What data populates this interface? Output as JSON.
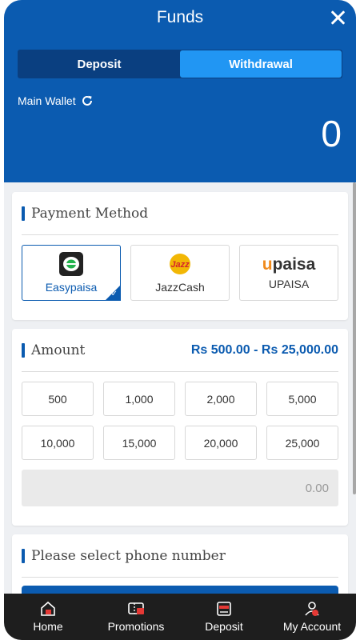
{
  "header": {
    "title": "Funds",
    "tabs": [
      {
        "label": "Deposit",
        "active": false
      },
      {
        "label": "Withdrawal",
        "active": true
      }
    ],
    "wallet_label": "Main Wallet",
    "wallet_value": "0"
  },
  "payment": {
    "title": "Payment Method",
    "methods": [
      {
        "name": "Easypaisa",
        "icon": "easypaisa-logo",
        "selected": true
      },
      {
        "name": "JazzCash",
        "icon": "jazz-logo",
        "selected": false
      },
      {
        "name": "UPAISA",
        "icon": "upaisa-logo",
        "selected": false
      }
    ],
    "upaisa_logo_u": "u",
    "upaisa_logo_rest": "paisa",
    "jazz_logo_text": "Jazz"
  },
  "amount": {
    "title": "Amount",
    "range": "Rs 500.00 - Rs 25,000.00",
    "options": [
      "500",
      "1,000",
      "2,000",
      "5,000",
      "10,000",
      "15,000",
      "20,000",
      "25,000"
    ],
    "input_value": "0.00"
  },
  "phone": {
    "title": "Please select phone number"
  },
  "nav": {
    "items": [
      {
        "label": "Home",
        "icon": "home-icon"
      },
      {
        "label": "Promotions",
        "icon": "promotions-icon"
      },
      {
        "label": "Deposit",
        "icon": "deposit-icon"
      },
      {
        "label": "My Account",
        "icon": "account-icon"
      }
    ]
  },
  "colors": {
    "primary": "#0b5bb0",
    "tab_active": "#2196f3",
    "nav_bg": "#1e1e1e",
    "accent_red": "#e53935"
  }
}
